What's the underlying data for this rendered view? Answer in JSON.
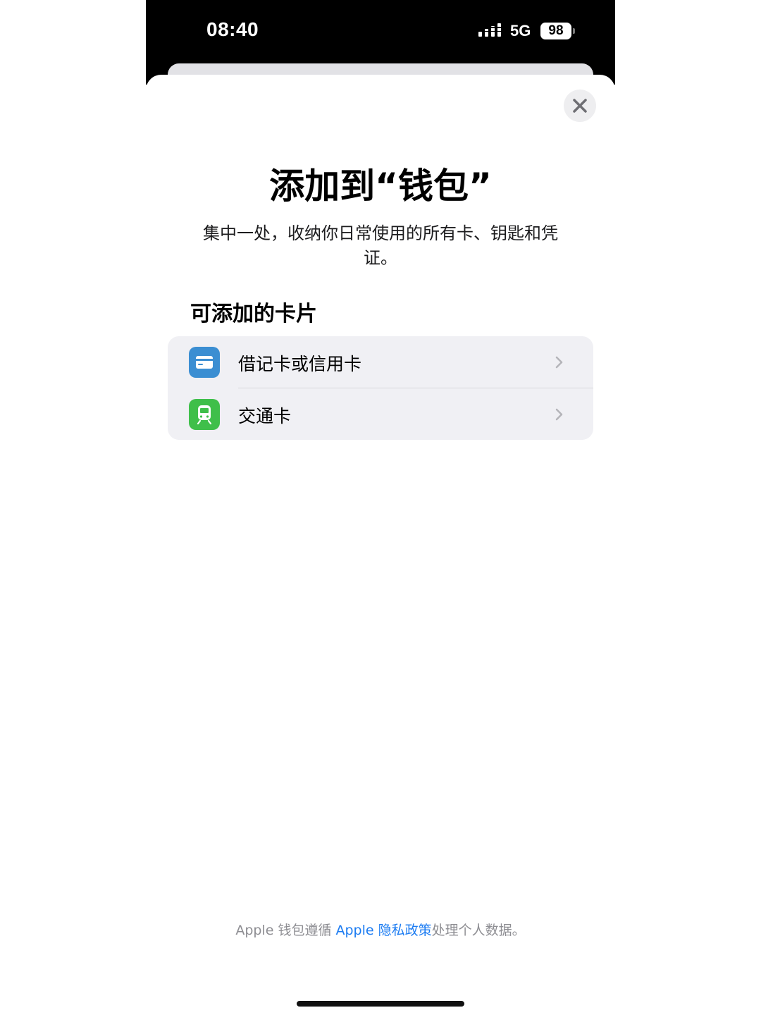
{
  "status_bar": {
    "time": "08:40",
    "network": "5G",
    "battery": "98"
  },
  "sheet": {
    "close_icon": "close-icon",
    "title": "添加到“钱包”",
    "subtitle": "集中一处，收纳你日常使用的所有卡、钥匙和凭证。",
    "section_header": "可添加的卡片",
    "items": [
      {
        "label": "借记卡或信用卡",
        "icon": "credit-card-icon",
        "icon_color": "#3b8ed2"
      },
      {
        "label": "交通卡",
        "icon": "train-icon",
        "icon_color": "#3fbf4a"
      }
    ],
    "footer": {
      "prefix": "Apple 钱包遵循 ",
      "link": "Apple 隐私政策",
      "suffix": "处理个人数据。"
    }
  },
  "colors": {
    "link": "#1c7cf2",
    "list_background": "#f0f0f4"
  }
}
